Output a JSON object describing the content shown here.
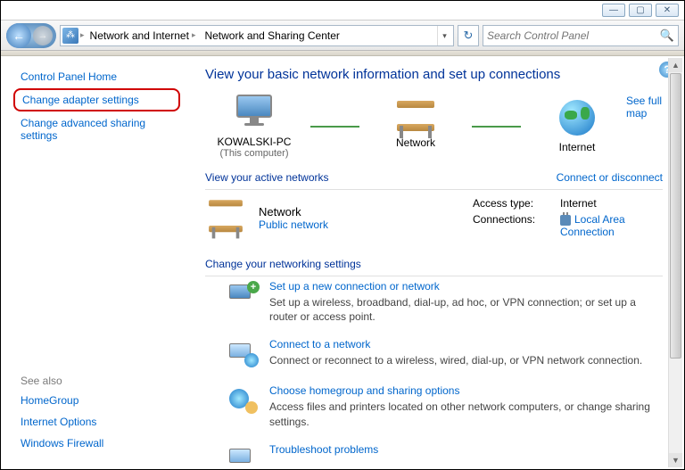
{
  "window": {
    "min": "—",
    "max": "▢",
    "close": "✕"
  },
  "breadcrumb": {
    "level1": "Network and Internet",
    "level2": "Network and Sharing Center"
  },
  "search": {
    "placeholder": "Search Control Panel"
  },
  "sidebar": {
    "home": "Control Panel Home",
    "adapter": "Change adapter settings",
    "advanced": "Change advanced sharing settings",
    "seealso_hdr": "See also",
    "seealso": {
      "homegroup": "HomeGroup",
      "inetopt": "Internet Options",
      "firewall": "Windows Firewall"
    }
  },
  "page": {
    "title": "View your basic network information and set up connections",
    "fullmap": "See full map",
    "nodes": {
      "comp": "KOWALSKI-PC",
      "comp_sub": "(This computer)",
      "net": "Network",
      "inet": "Internet"
    },
    "active_hdr": "View your active networks",
    "connect_disconnect": "Connect or disconnect",
    "active": {
      "name": "Network",
      "type": "Public network",
      "access_lbl": "Access type:",
      "access_val": "Internet",
      "conn_lbl": "Connections:",
      "conn_val": "Local Area Connection"
    },
    "settings_hdr": "Change your networking settings",
    "tasks": [
      {
        "title": "Set up a new connection or network",
        "desc": "Set up a wireless, broadband, dial-up, ad hoc, or VPN connection; or set up a router or access point."
      },
      {
        "title": "Connect to a network",
        "desc": "Connect or reconnect to a wireless, wired, dial-up, or VPN network connection."
      },
      {
        "title": "Choose homegroup and sharing options",
        "desc": "Access files and printers located on other network computers, or change sharing settings."
      },
      {
        "title": "Troubleshoot problems",
        "desc": ""
      }
    ]
  }
}
